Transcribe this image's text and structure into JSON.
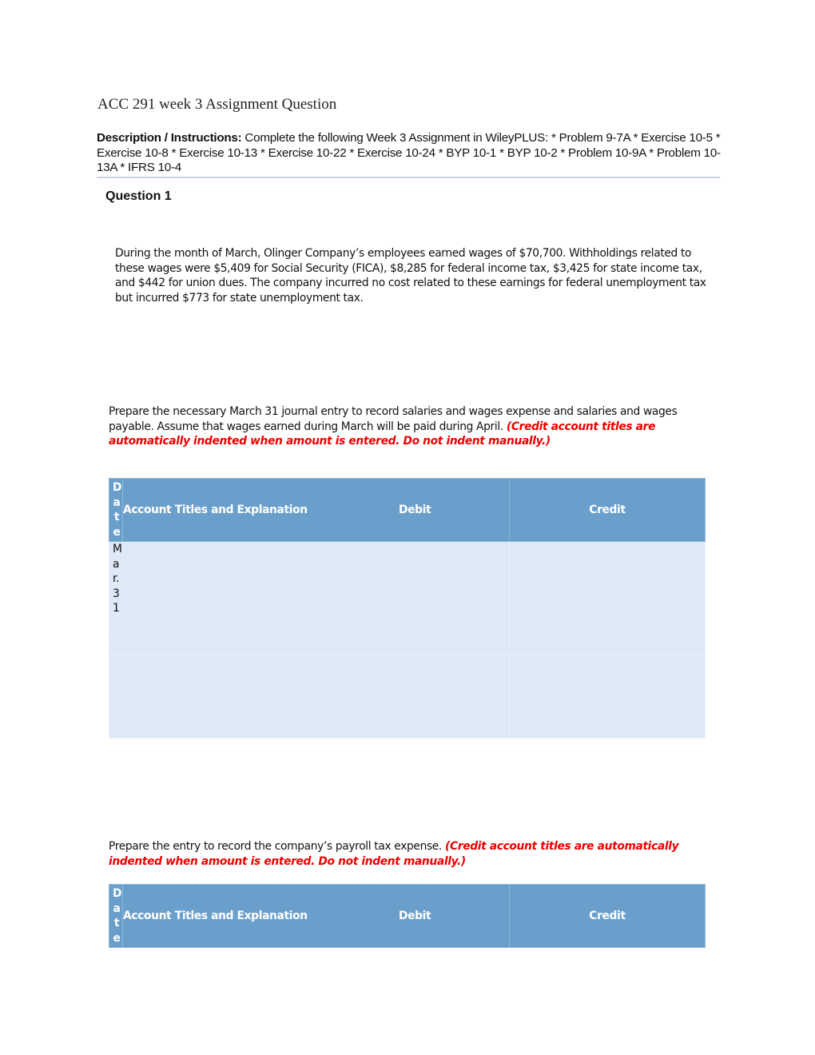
{
  "document": {
    "title": "ACC 291 week 3 Assignment Question",
    "description_label": "Description / Instructions:",
    "description_text": " Complete the following Week 3 Assignment in WileyPLUS: * Problem 9-7A * Exercise 10-5 * Exercise 10-8 * Exercise 10-13 * Exercise 10-22 * Exercise 10-24 * BYP 10-1 * BYP 10-2 * Problem 10-9A * Problem 10-13A * IFRS 10-4"
  },
  "question": {
    "heading": "Question 1",
    "scenario": "During the month of March, Olinger Company’s employees earned wages of $70,700. Withholdings related to these wages were $5,409 for Social Security (FICA), $8,285 for federal income tax, $3,425 for state income tax, and $442 for union dues. The company incurred no cost related to these earnings for federal unemployment tax but incurred $773 for state unemployment tax.",
    "part_a": {
      "prompt": "Prepare the necessary March 31 journal entry to record salaries and wages expense and salaries and wages payable. Assume that wages earned during March will be paid during April. ",
      "note": "(Credit account titles are automatically indented when amount is entered. Do not indent manually.)",
      "table": {
        "headers": {
          "date": "Date",
          "account": "Account Titles and Explanation",
          "debit": "Debit",
          "credit": "Credit"
        },
        "rows": [
          {
            "date": "Mar. 31",
            "account": "",
            "debit": "",
            "credit": ""
          },
          {
            "date": "",
            "account": "",
            "debit": "",
            "credit": ""
          },
          {
            "date": "",
            "account": "",
            "debit": "",
            "credit": ""
          }
        ]
      }
    },
    "part_b": {
      "prompt": "Prepare the entry to record the company’s payroll tax expense. ",
      "note": "(Credit account titles are automatically indented when amount is entered. Do not indent manually.)",
      "table": {
        "headers": {
          "date": "Date",
          "account": "Account Titles and Explanation",
          "debit": "Debit",
          "credit": "Credit"
        }
      }
    }
  }
}
